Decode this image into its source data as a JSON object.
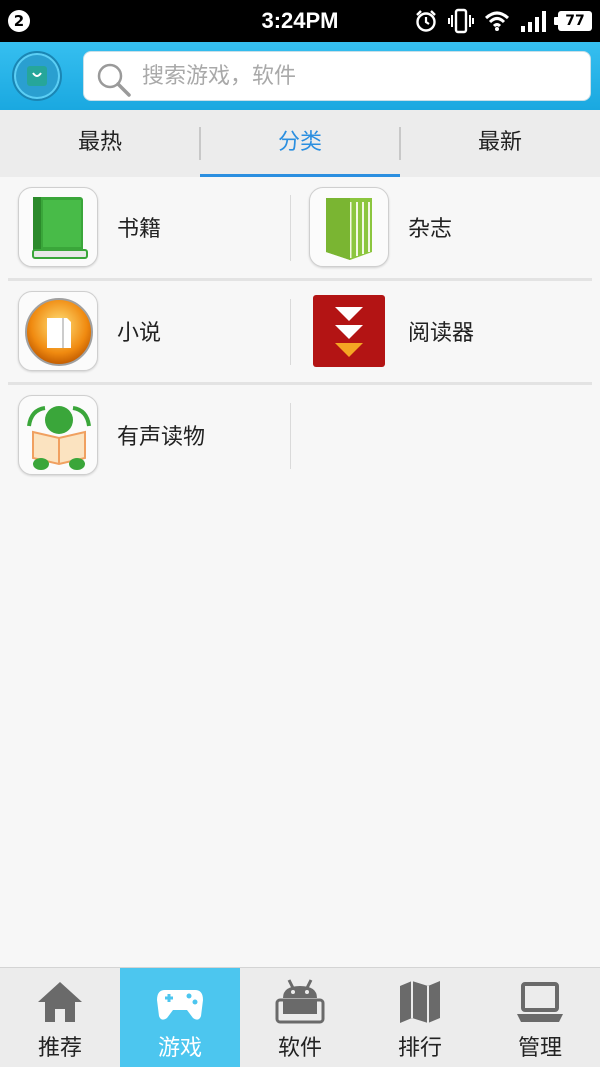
{
  "status_bar": {
    "notification_count": "2",
    "time": "3:24PM",
    "battery": "77",
    "icons": [
      "alarm-icon",
      "vibrate-icon",
      "wifi-icon",
      "signal-icon",
      "battery-icon"
    ]
  },
  "header": {
    "logo_icon": "store-bag-icon",
    "search": {
      "placeholder": "搜索游戏，软件",
      "value": ""
    }
  },
  "tabs": [
    {
      "label": "最热",
      "active": false
    },
    {
      "label": "分类",
      "active": true
    },
    {
      "label": "最新",
      "active": false
    }
  ],
  "categories": [
    {
      "label": "书籍",
      "icon": "book-icon"
    },
    {
      "label": "杂志",
      "icon": "magazine-icon"
    },
    {
      "label": "小说",
      "icon": "novel-icon"
    },
    {
      "label": "阅读器",
      "icon": "reader-icon"
    },
    {
      "label": "有声读物",
      "icon": "audiobook-icon"
    }
  ],
  "bottom_nav": [
    {
      "label": "推荐",
      "icon": "home-icon",
      "active": false
    },
    {
      "label": "游戏",
      "icon": "gamepad-icon",
      "active": true
    },
    {
      "label": "软件",
      "icon": "android-icon",
      "active": false
    },
    {
      "label": "排行",
      "icon": "map-icon",
      "active": false
    },
    {
      "label": "管理",
      "icon": "laptop-icon",
      "active": false
    }
  ],
  "colors": {
    "header": "#1aa8e0",
    "accent": "#2b8fe0",
    "nav_active": "#4cc6ef"
  }
}
